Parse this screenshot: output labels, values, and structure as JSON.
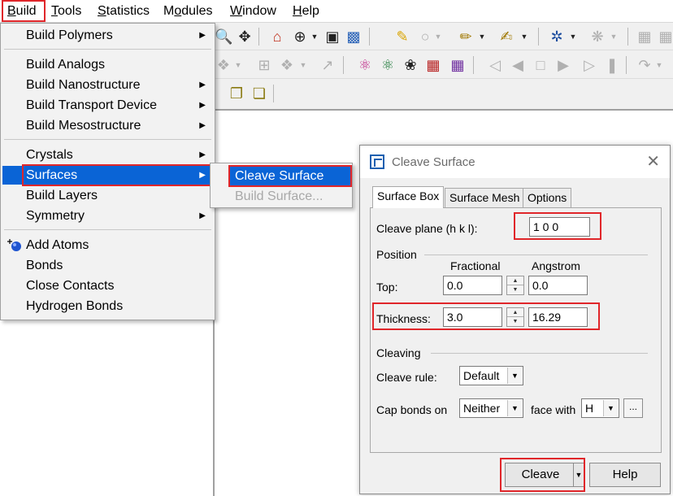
{
  "menubar": {
    "items": [
      {
        "label": "Build",
        "mnemonic": "B"
      },
      {
        "label": "Tools",
        "mnemonic": "T"
      },
      {
        "label": "Statistics",
        "mnemonic": "S"
      },
      {
        "label": "Modules",
        "mnemonic": "o"
      },
      {
        "label": "Window",
        "mnemonic": "W"
      },
      {
        "label": "Help",
        "mnemonic": "H"
      }
    ]
  },
  "build_menu": {
    "items": [
      {
        "label": "Build Polymers",
        "has_submenu": true
      },
      {
        "label": "Build Analogs",
        "has_submenu": false
      },
      {
        "label": "Build Nanostructure",
        "has_submenu": true
      },
      {
        "label": "Build Transport Device",
        "has_submenu": true
      },
      {
        "label": "Build Mesostructure",
        "has_submenu": true
      },
      {
        "label": "Crystals",
        "has_submenu": true
      },
      {
        "label": "Surfaces",
        "has_submenu": true
      },
      {
        "label": "Build Layers",
        "has_submenu": false
      },
      {
        "label": "Symmetry",
        "has_submenu": true
      },
      {
        "label": "Add Atoms",
        "has_submenu": false,
        "icon": "add-atoms-icon"
      },
      {
        "label": "Bonds",
        "has_submenu": false
      },
      {
        "label": "Close Contacts",
        "has_submenu": false
      },
      {
        "label": "Hydrogen Bonds",
        "has_submenu": false
      }
    ]
  },
  "surfaces_submenu": {
    "items": [
      {
        "label": "Cleave Surface",
        "enabled": true
      },
      {
        "label": "Build Surface...",
        "enabled": false
      }
    ]
  },
  "dialog": {
    "title": "Cleave Surface",
    "tabs": [
      "Surface Box",
      "Surface Mesh",
      "Options"
    ],
    "selected_tab": "Surface Box",
    "cleave_plane": {
      "label": "Cleave plane (h k l):",
      "value": "1  0  0"
    },
    "position": {
      "group_label": "Position",
      "col_fractional": "Fractional",
      "col_angstrom": "Angstrom",
      "top_label": "Top:",
      "top_fractional": "0.0",
      "top_angstrom": "0.0",
      "thickness_label": "Thickness:",
      "thickness_fractional": "3.0",
      "thickness_angstrom": "16.29"
    },
    "cleaving": {
      "group_label": "Cleaving",
      "cleave_rule_label": "Cleave rule:",
      "cleave_rule_value": "Default",
      "cap_bonds_label": "Cap bonds on",
      "cap_bonds_value": "Neither",
      "face_with_label": "face with",
      "face_with_value": "H",
      "ellipsis_label": "..."
    },
    "buttons": {
      "cleave": "Cleave",
      "help": "Help"
    }
  },
  "colors": {
    "highlight": "#0a64d6",
    "annotation_red": "#e0262a",
    "dialog_icon_blue": "#1c5fb0"
  }
}
